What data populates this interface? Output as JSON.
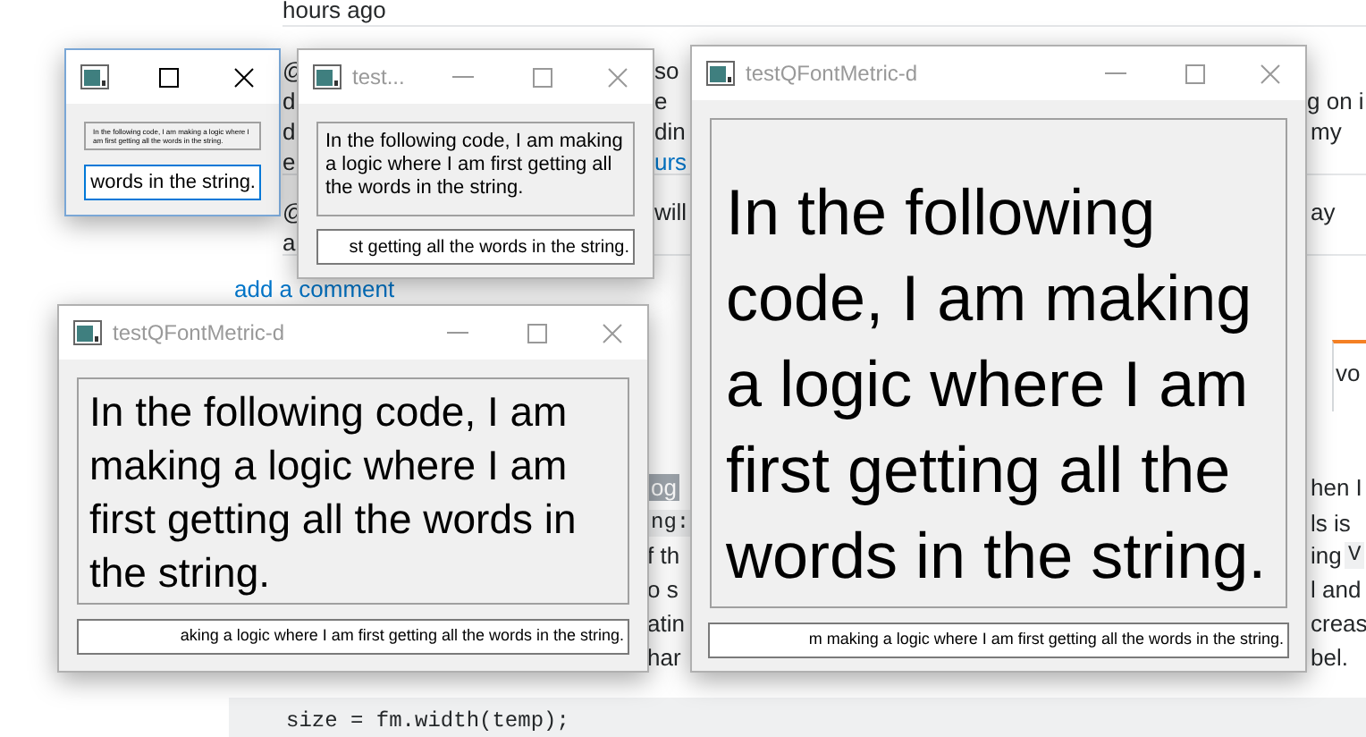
{
  "page": {
    "fragments": [
      {
        "text": "hours ago",
        "kind": "text"
      },
      {
        "text": "@",
        "kind": "text"
      },
      {
        "text": "d",
        "kind": "text"
      },
      {
        "text": "d",
        "kind": "text"
      },
      {
        "text": "e",
        "kind": "text"
      },
      {
        "text": "so",
        "kind": "text"
      },
      {
        "text": "e",
        "kind": "text"
      },
      {
        "text": "din",
        "kind": "text"
      },
      {
        "text": "urs",
        "kind": "link"
      },
      {
        "text": "g on i",
        "kind": "text"
      },
      {
        "text": "my",
        "kind": "text"
      },
      {
        "text": "@",
        "kind": "text"
      },
      {
        "text": "a",
        "kind": "text"
      },
      {
        "text": "will",
        "kind": "text"
      },
      {
        "text": "ay",
        "kind": "text"
      },
      {
        "text": "add a comment",
        "kind": "link"
      },
      {
        "text": "vo",
        "kind": "text"
      },
      {
        "text": "og",
        "kind": "chip"
      },
      {
        "text": "ng:",
        "kind": "code"
      },
      {
        "text": "f th",
        "kind": "text"
      },
      {
        "text": "o s",
        "kind": "text"
      },
      {
        "text": "atin",
        "kind": "text"
      },
      {
        "text": "har",
        "kind": "text"
      },
      {
        "text": "hen I",
        "kind": "text"
      },
      {
        "text": "ls is",
        "kind": "text"
      },
      {
        "text": "ing",
        "kind": "text"
      },
      {
        "text": "V",
        "kind": "code"
      },
      {
        "text": "l and",
        "kind": "text"
      },
      {
        "text": "creas",
        "kind": "text"
      },
      {
        "text": "bel.",
        "kind": "text"
      }
    ],
    "code_line": "size = fm.width(temp);"
  },
  "windows": [
    {
      "active": true,
      "label": "In the following code, I am making a logic where I am first getting all the words in the string.",
      "input": "words in the string."
    },
    {
      "title": "test...",
      "active": false,
      "label": "In the following code, I am making a logic where I am first getting all the words in the string.",
      "input": "st getting all the words in the string."
    },
    {
      "title": "testQFontMetric-d",
      "active": false,
      "label": "In the following code, I am making a logic where I am first getting all the words in the string.",
      "input": "aking a logic where I am first getting all the words in the string."
    },
    {
      "title": "testQFontMetric-d",
      "active": false,
      "label": "In the following code, I am making a logic where I am first getting all the words in the string.",
      "input": "m making a logic where I am first getting all the words in the string."
    }
  ]
}
